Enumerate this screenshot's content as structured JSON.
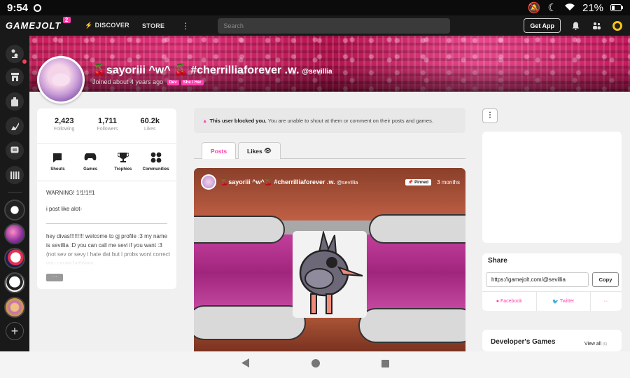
{
  "status_bar": {
    "time": "9:54",
    "battery": "21%"
  },
  "nav": {
    "logo": "GAMEJOLT",
    "logo_badge": "2",
    "discover": "DISCOVER",
    "store": "STORE",
    "search_placeholder": "Search",
    "get_app": "Get App"
  },
  "profile": {
    "display_name": "🍒sayoriii ^w^ 🍒 #cherrilliaforever .w.",
    "handle": "@sevillia",
    "joined": "Joined about 4 years ago",
    "tags": [
      "Dev",
      "She / Her"
    ],
    "stats": [
      {
        "value": "2,423",
        "label": "Following"
      },
      {
        "value": "1,711",
        "label": "Followers"
      },
      {
        "value": "60.2k",
        "label": "Likes"
      }
    ],
    "sections": [
      {
        "label": "Shouts",
        "icon": "shouts-icon"
      },
      {
        "label": "Games",
        "icon": "gamepad-icon"
      },
      {
        "label": "Trophies",
        "icon": "trophy-icon"
      },
      {
        "label": "Communities",
        "icon": "communities-icon"
      }
    ],
    "bio_line1": "WARNING! 1!1!1!!1",
    "bio_line2": "i post like alot-",
    "bio_line3": "hey divas!!!!!!!!! welcome to gj profile :3 my name is sevillia :D you can call me sevi if you want :3 (not sev or sevy i hate dat but i probs wont correct you cause laziness",
    "more_label": "···"
  },
  "notice": {
    "bold": "This user blocked you.",
    "text": "You are unable to shout at them or comment on their posts and games."
  },
  "tabs": {
    "posts": "Posts",
    "likes": "Likes"
  },
  "post": {
    "author": "🍒sayoriii ^w^🍒 #cherrilliaforever .w.",
    "handle": "@sevillia",
    "pinned": "Pinned",
    "time": "3 months"
  },
  "share": {
    "title": "Share",
    "url": "https://gamejolt.com/@sevillia",
    "copy": "Copy",
    "facebook": "Facebook",
    "twitter": "Twitter",
    "more": "···"
  },
  "dev_games": {
    "title": "Developer's Games",
    "view_all": "View all",
    "count": "(6)"
  },
  "colors": {
    "accent": "#ff3fac",
    "dark": "#191919",
    "banner": "#c81e5a"
  }
}
